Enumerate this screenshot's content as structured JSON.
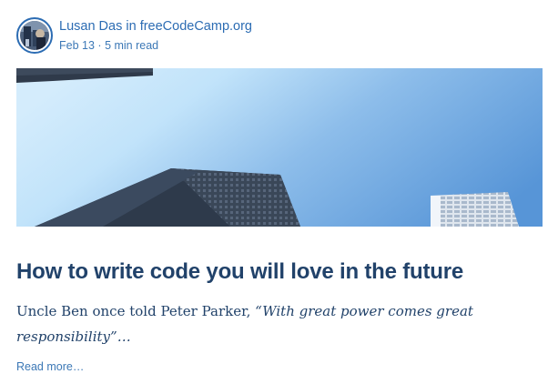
{
  "post": {
    "author_name": "Lusan Das",
    "in_word": "in",
    "publication": "freeCodeCamp.org",
    "date": "Feb 13",
    "separator": "·",
    "read_time": "5 min read",
    "title": "How to write code you will love in the future",
    "excerpt_plain": "Uncle Ben once told Peter Parker, ",
    "excerpt_quote_line1": "“With great power comes great",
    "excerpt_quote_line2": "responsibility”…",
    "read_more": "Read more…"
  },
  "colors": {
    "link_blue": "#2c6cb3",
    "title_navy": "#21426a",
    "sky_light": "#c9e6fb",
    "sky_dark": "#5b98d8"
  },
  "icons": {
    "avatar": "author-avatar",
    "hero": "skyscrapers-looking-up-photo"
  }
}
